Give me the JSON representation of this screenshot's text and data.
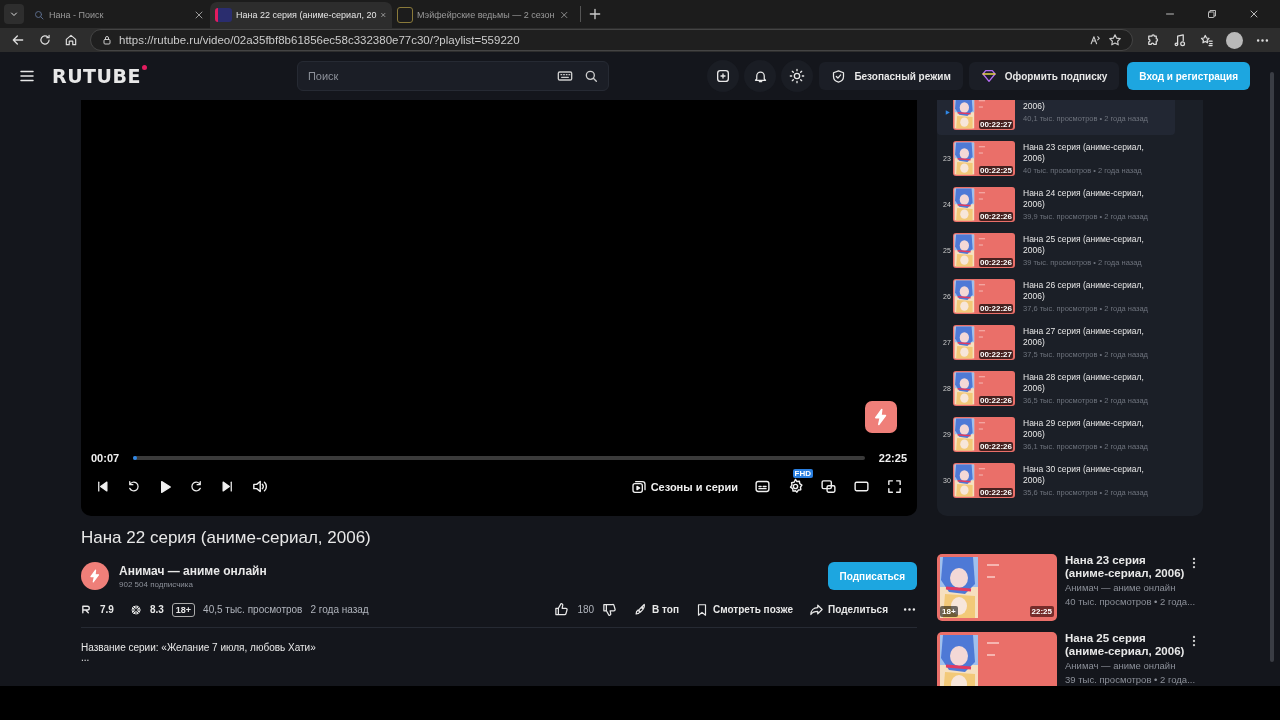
{
  "browser": {
    "tabs": [
      {
        "title": "Нана - Поиск",
        "selected": false,
        "kind": "search"
      },
      {
        "title": "Нана 22 серия (аниме-сериал, 20",
        "selected": true,
        "kind": "rutube"
      },
      {
        "title": "Мэйфейрские ведьмы — 2 сезон",
        "selected": false,
        "kind": "letter"
      }
    ],
    "url": "https://rutube.ru/video/02a35fbf8b61856ec58c332380e77c30/?playlist=559220"
  },
  "header": {
    "logo": "RUTUBE",
    "search_placeholder": "Поиск",
    "buttons": [
      {
        "kind": "safe",
        "label": "Безопасный режим"
      },
      {
        "kind": "premium",
        "label": "Оформить подписку"
      },
      {
        "kind": "login",
        "label": "Вход и регистрация"
      }
    ]
  },
  "player": {
    "current_time": "00:07",
    "duration": "22:25",
    "level": 0.005,
    "seasons_button": "Сезоны и серии",
    "quality_badge": "FHD"
  },
  "playlist": {
    "items": [
      {
        "title": "2006)",
        "meta": "40,1 тыс. просмотров • 2 года назад",
        "duration": "00:22:27",
        "selected": true
      },
      {
        "number": "23",
        "title": "Нана 23 серия (аниме-сериал, 2006)",
        "meta": "40 тыс. просмотров • 2 года назад",
        "duration": "00:22:25",
        "selected": false
      },
      {
        "number": "24",
        "title": "Нана 24 серия (аниме-сериал, 2006)",
        "meta": "39,9 тыс. просмотров • 2 года назад",
        "duration": "00:22:26",
        "selected": false
      },
      {
        "number": "25",
        "title": "Нана 25 серия (аниме-сериал, 2006)",
        "meta": "39 тыс. просмотров • 2 года назад",
        "duration": "00:22:26",
        "selected": false
      },
      {
        "number": "26",
        "title": "Нана 26 серия (аниме-сериал, 2006)",
        "meta": "37,6 тыс. просмотров • 2 года назад",
        "duration": "00:22:26",
        "selected": false
      },
      {
        "number": "27",
        "title": "Нана 27 серия (аниме-сериал, 2006)",
        "meta": "37,5 тыс. просмотров • 2 года назад",
        "duration": "00:22:27",
        "selected": false
      },
      {
        "number": "28",
        "title": "Нана 28 серия (аниме-сериал, 2006)",
        "meta": "36,5 тыс. просмотров • 2 года назад",
        "duration": "00:22:26",
        "selected": false
      },
      {
        "number": "29",
        "title": "Нана 29 серия (аниме-сериал, 2006)",
        "meta": "36,1 тыс. просмотров • 2 года назад",
        "duration": "00:22:26",
        "selected": false
      },
      {
        "number": "30",
        "title": "Нана 30 серия (аниме-сериал, 2006)",
        "meta": "35,6 тыс. просмотров • 2 года назад",
        "duration": "00:22:26",
        "selected": false
      }
    ]
  },
  "video": {
    "title": "Нана 22 серия (аниме-сериал, 2006)",
    "channel": "Анимач — аниме онлайн",
    "subscribers": "902 504 подписчика",
    "subscribe_button": "Подписаться",
    "rating_rutube": "7.9",
    "rating_kinopoisk": "8.3",
    "age": "18+",
    "views": "40,5 тыс. просмотров",
    "date": "2 года назад",
    "likes": "180",
    "actions": [
      {
        "kind": "top",
        "label": "В топ"
      },
      {
        "kind": "later",
        "label": "Смотреть позже"
      },
      {
        "kind": "share",
        "label": "Поделиться"
      }
    ],
    "description": "Название серии: «Желание 7 июля, любовь Хати»",
    "more": "..."
  },
  "recommendations": [
    {
      "title": "Нана 23 серия (аниме-сериал, 2006)",
      "channel": "Анимач — аниме онлайн",
      "meta": "40 тыс. просмотров • 2 года...",
      "age": "18+",
      "duration": "22:25"
    },
    {
      "title": "Нана 25 серия (аниме-сериал, 2006)",
      "channel": "Анимач — аниме онлайн",
      "meta": "39 тыс. просмотров • 2 года..."
    }
  ]
}
